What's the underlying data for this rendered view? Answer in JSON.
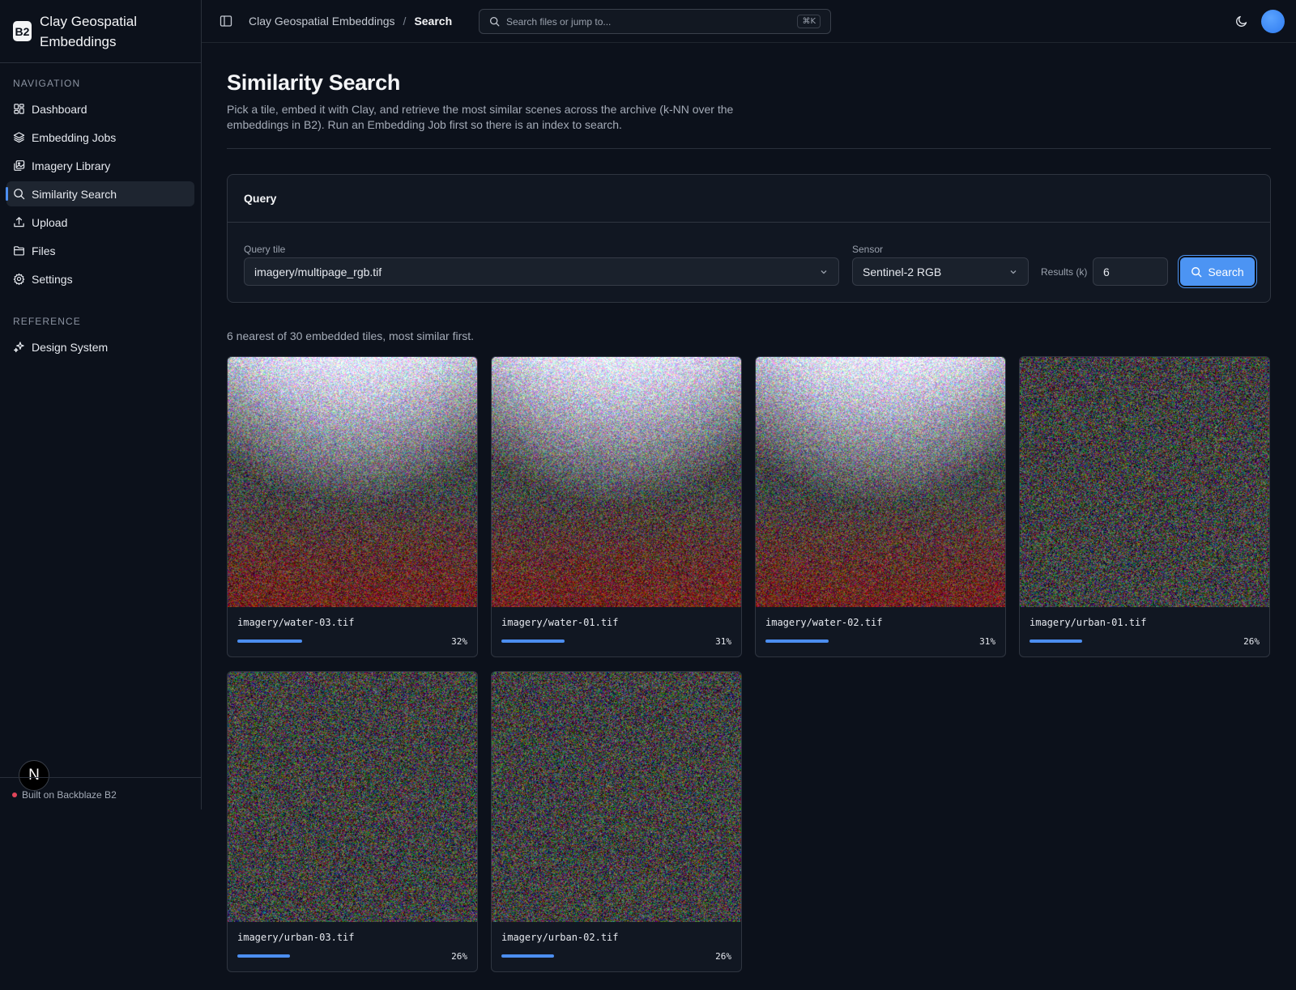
{
  "brand": {
    "logo": "B2",
    "name": "Clay Geospatial Embeddings"
  },
  "sidebar": {
    "nav_heading": "NAVIGATION",
    "nav_items": [
      {
        "label": "Dashboard",
        "icon": "dashboard-icon"
      },
      {
        "label": "Embedding Jobs",
        "icon": "layers-icon"
      },
      {
        "label": "Imagery Library",
        "icon": "images-icon"
      },
      {
        "label": "Similarity Search",
        "icon": "search-icon",
        "active": true
      },
      {
        "label": "Upload",
        "icon": "upload-icon"
      },
      {
        "label": "Files",
        "icon": "folder-icon"
      },
      {
        "label": "Settings",
        "icon": "gear-icon"
      }
    ],
    "reference_heading": "REFERENCE",
    "reference_items": [
      {
        "label": "Design System",
        "icon": "sparkles-icon"
      }
    ],
    "footer": "Built on Backblaze B2",
    "badge": "N"
  },
  "topbar": {
    "breadcrumb_root": "Clay Geospatial Embeddings",
    "breadcrumb_sep": "/",
    "breadcrumb_current": "Search",
    "search_placeholder": "Search files or jump to...",
    "search_shortcut": "⌘K"
  },
  "page": {
    "title": "Similarity Search",
    "description": "Pick a tile, embed it with Clay, and retrieve the most similar scenes across the archive (k-NN over the embeddings in B2). Run an Embedding Job first so there is an index to search."
  },
  "query": {
    "card_title": "Query",
    "tile_label": "Query tile",
    "tile_value": "imagery/multipage_rgb.tif",
    "sensor_label": "Sensor",
    "sensor_value": "Sentinel-2 RGB",
    "k_label": "Results (k)",
    "k_value": "6",
    "search_button": "Search"
  },
  "results": {
    "summary": "6 nearest of 30 embedded tiles, most similar first.",
    "tiles": [
      {
        "name": "imagery/water-03.tif",
        "score": "32%",
        "fraction": 0.32,
        "kind": "water"
      },
      {
        "name": "imagery/water-01.tif",
        "score": "31%",
        "fraction": 0.31,
        "kind": "water"
      },
      {
        "name": "imagery/water-02.tif",
        "score": "31%",
        "fraction": 0.31,
        "kind": "water"
      },
      {
        "name": "imagery/urban-01.tif",
        "score": "26%",
        "fraction": 0.26,
        "kind": "urban"
      },
      {
        "name": "imagery/urban-03.tif",
        "score": "26%",
        "fraction": 0.26,
        "kind": "urban"
      },
      {
        "name": "imagery/urban-02.tif",
        "score": "26%",
        "fraction": 0.26,
        "kind": "urban"
      }
    ]
  },
  "colors": {
    "accent": "#4c8ef0",
    "background": "#0c111b",
    "status_dot": "#e2455a"
  }
}
